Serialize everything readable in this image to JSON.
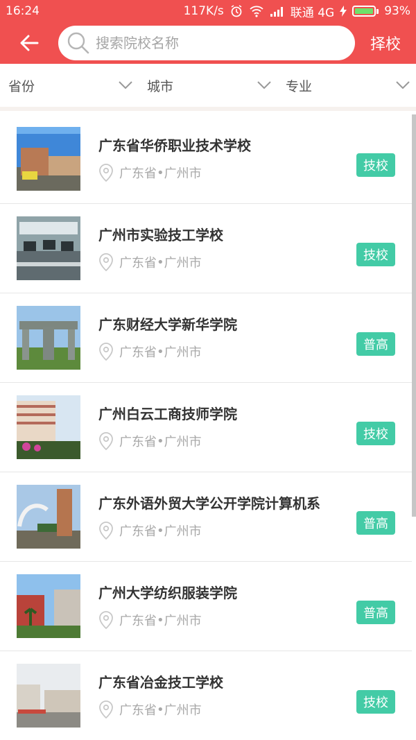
{
  "status": {
    "time": "16:24",
    "speed": "117K/s",
    "carrier": "联通 4G",
    "battery": "93%"
  },
  "header": {
    "search_placeholder": "搜索院校名称",
    "action_label": "择校"
  },
  "filters": [
    {
      "label": "省份"
    },
    {
      "label": "城市"
    },
    {
      "label": "专业"
    }
  ],
  "schools": [
    {
      "name": "广东省华侨职业技术学校",
      "province": "广东省",
      "city": "广州市",
      "tag": "技校"
    },
    {
      "name": "广州市实验技工学校",
      "province": "广东省",
      "city": "广州市",
      "tag": "技校"
    },
    {
      "name": "广东财经大学新华学院",
      "province": "广东省",
      "city": "广州市",
      "tag": "普高"
    },
    {
      "name": "广州白云工商技师学院",
      "province": "广东省",
      "city": "广州市",
      "tag": "技校"
    },
    {
      "name": "广东外语外贸大学公开学院计算机系",
      "province": "广东省",
      "city": "广州市",
      "tag": "普高"
    },
    {
      "name": "广州大学纺织服装学院",
      "province": "广东省",
      "city": "广州市",
      "tag": "普高"
    },
    {
      "name": "广东省冶金技工学校",
      "province": "广东省",
      "city": "广州市",
      "tag": "技校"
    }
  ],
  "colors": {
    "header": "#f05050",
    "badge": "#43cba6"
  }
}
